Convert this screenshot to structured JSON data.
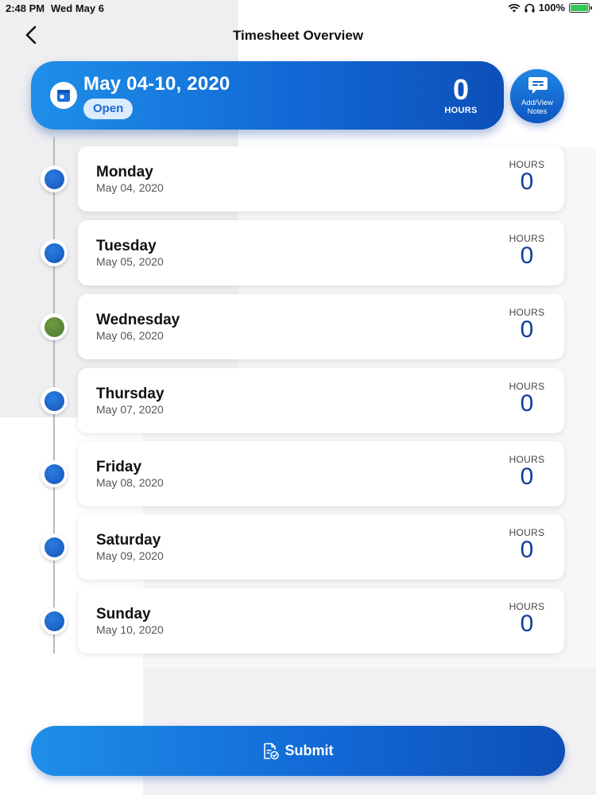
{
  "status_bar": {
    "time": "2:48 PM",
    "date": "Wed May 6",
    "battery": "100%"
  },
  "nav": {
    "title": "Timesheet Overview"
  },
  "week": {
    "range": "May 04-10, 2020",
    "status": "Open",
    "total_hours": "0",
    "hours_label": "HOURS"
  },
  "notes_button": {
    "line1": "Add/View",
    "line2": "Notes"
  },
  "days": [
    {
      "name": "Monday",
      "date": "May 04, 2020",
      "hours_label": "HOURS",
      "hours": "0",
      "today": false
    },
    {
      "name": "Tuesday",
      "date": "May 05, 2020",
      "hours_label": "HOURS",
      "hours": "0",
      "today": false
    },
    {
      "name": "Wednesday",
      "date": "May 06, 2020",
      "hours_label": "HOURS",
      "hours": "0",
      "today": true
    },
    {
      "name": "Thursday",
      "date": "May 07, 2020",
      "hours_label": "HOURS",
      "hours": "0",
      "today": false
    },
    {
      "name": "Friday",
      "date": "May 08, 2020",
      "hours_label": "HOURS",
      "hours": "0",
      "today": false
    },
    {
      "name": "Saturday",
      "date": "May 09, 2020",
      "hours_label": "HOURS",
      "hours": "0",
      "today": false
    },
    {
      "name": "Sunday",
      "date": "May 10, 2020",
      "hours_label": "HOURS",
      "hours": "0",
      "today": false
    }
  ],
  "submit": {
    "label": "Submit"
  },
  "colors": {
    "accent": "#1269d6",
    "today_dot": "#5b8737",
    "hours_value": "#103d99"
  }
}
